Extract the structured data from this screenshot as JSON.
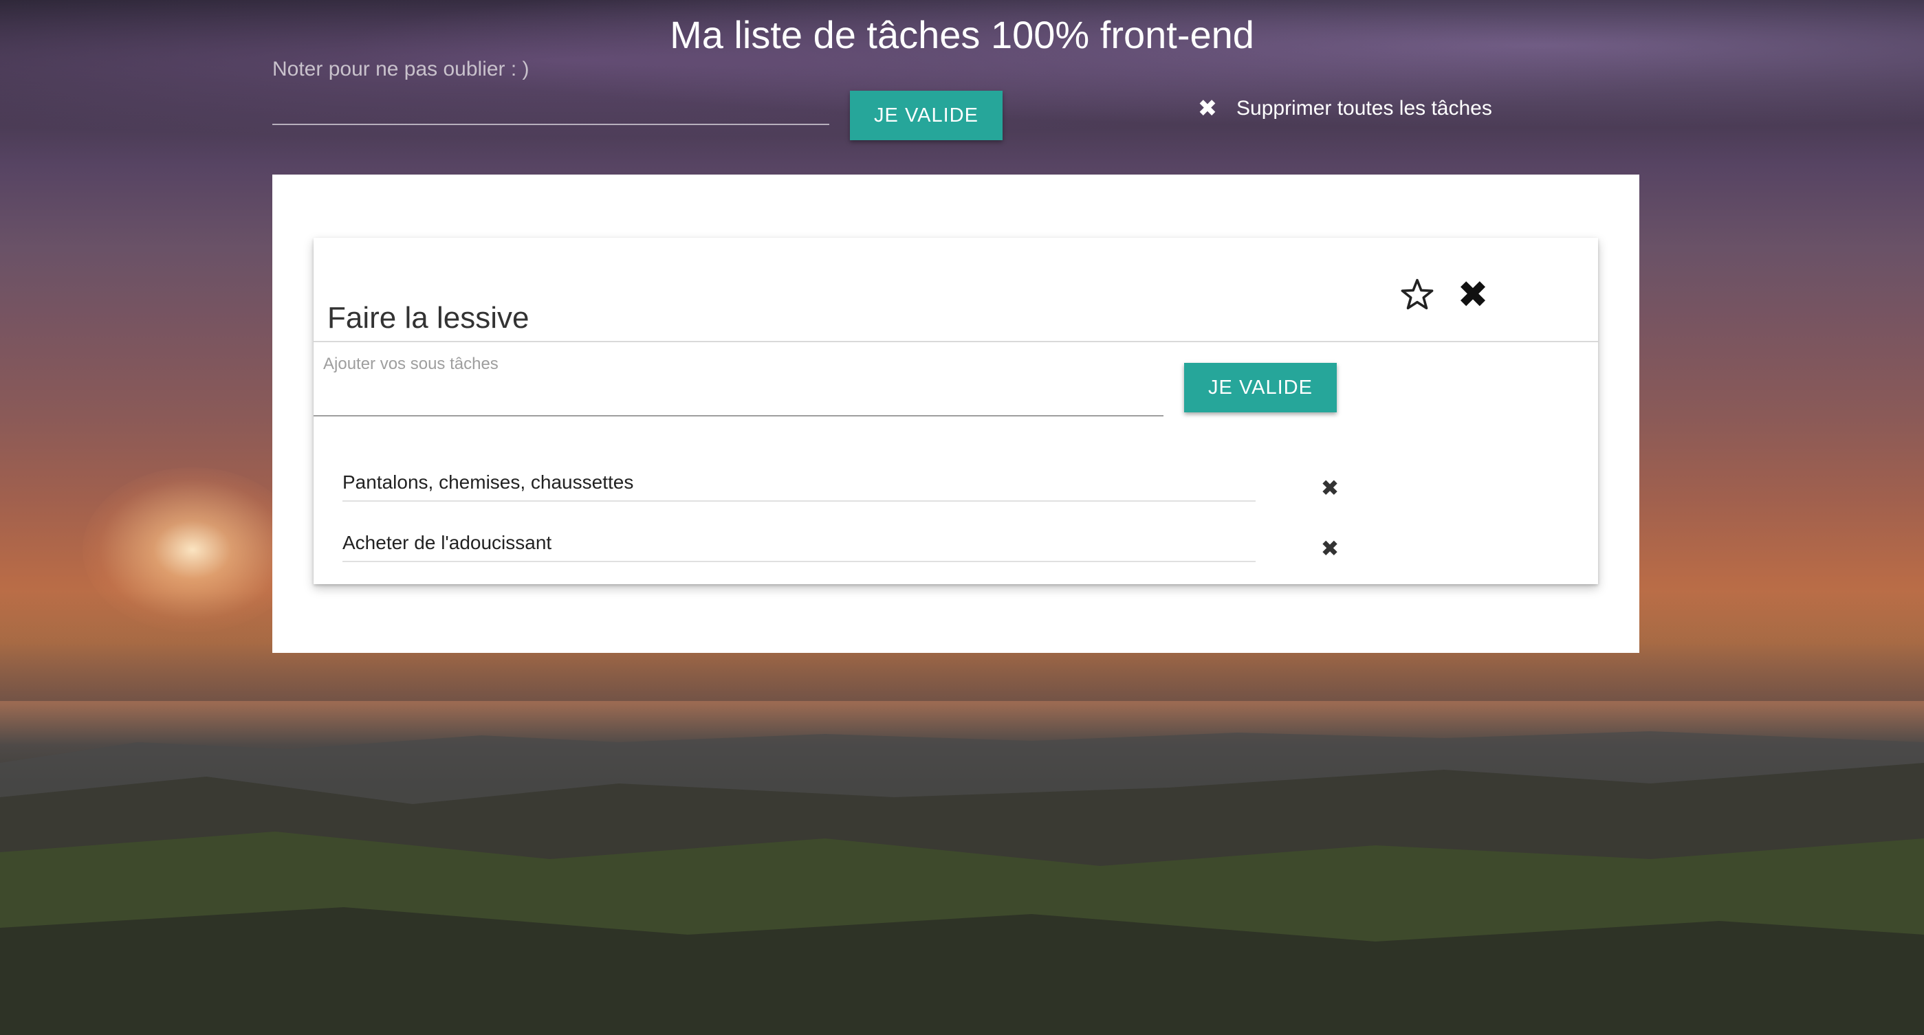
{
  "header": {
    "title": "Ma liste de tâches 100% front-end"
  },
  "new_task": {
    "placeholder": "Noter pour ne pas oublier : )",
    "value": "",
    "button_label": "Je valide"
  },
  "clear_all": {
    "icon": "close-icon",
    "label": "Supprimer toutes les tâches"
  },
  "tasks": [
    {
      "title": "Faire la lessive",
      "star_icon": "star-outline-icon",
      "delete_icon": "close-icon",
      "subtask_input": {
        "placeholder": "Ajouter vos sous tâches",
        "value": "",
        "button_label": "Je valide"
      },
      "subtasks": [
        {
          "text": "Pantalons, chemises, chaussettes",
          "delete_icon": "close-icon"
        },
        {
          "text": "Acheter de l'adoucissant",
          "delete_icon": "close-icon"
        }
      ]
    }
  ],
  "colors": {
    "accent": "#26a69a",
    "card_background": "#ffffff",
    "title_text": "#ffffff"
  }
}
